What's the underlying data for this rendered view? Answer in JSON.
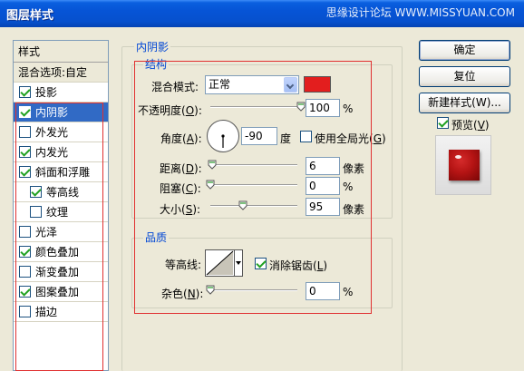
{
  "window": {
    "title": "图层样式",
    "watermark": "思缘设计论坛 WWW.MISSYUAN.COM"
  },
  "style_list": {
    "header": "样式",
    "blend_options": "混合选项:自定",
    "items": [
      {
        "label": "投影",
        "checked": true,
        "sub": false,
        "selected": false
      },
      {
        "label": "内阴影",
        "checked": true,
        "sub": false,
        "selected": true
      },
      {
        "label": "外发光",
        "checked": false,
        "sub": false,
        "selected": false
      },
      {
        "label": "内发光",
        "checked": true,
        "sub": false,
        "selected": false
      },
      {
        "label": "斜面和浮雕",
        "checked": true,
        "sub": false,
        "selected": false
      },
      {
        "label": "等高线",
        "checked": true,
        "sub": true,
        "selected": false
      },
      {
        "label": "纹理",
        "checked": false,
        "sub": true,
        "selected": false
      },
      {
        "label": "光泽",
        "checked": false,
        "sub": false,
        "selected": false
      },
      {
        "label": "颜色叠加",
        "checked": true,
        "sub": false,
        "selected": false
      },
      {
        "label": "渐变叠加",
        "checked": false,
        "sub": false,
        "selected": false
      },
      {
        "label": "图案叠加",
        "checked": true,
        "sub": false,
        "selected": false
      },
      {
        "label": "描边",
        "checked": false,
        "sub": false,
        "selected": false
      }
    ]
  },
  "panel": {
    "title": "内阴影",
    "structure": {
      "title": "结构",
      "blend_mode_label": "混合模式:",
      "blend_mode_value": "正常",
      "shadow_color": "#e31e1e",
      "opacity_label": "不透明度(",
      "opacity_key": "O",
      "opacity_value": "100",
      "opacity_unit": "%",
      "opacity_fraction": 1.0,
      "angle_label": "角度(",
      "angle_key": "A",
      "angle_value": "-90",
      "angle_unit": "度",
      "global_light_label": "使用全局光(",
      "global_light_key": "G",
      "global_light_checked": false,
      "distance_label": "距离(",
      "distance_key": "D",
      "distance_value": "6",
      "distance_unit": "像素",
      "distance_fraction": 0.02,
      "choke_label": "阻塞(",
      "choke_key": "C",
      "choke_value": "0",
      "choke_unit": "%",
      "choke_fraction": 0.0,
      "size_label": "大小(",
      "size_key": "S",
      "size_value": "95",
      "size_unit": "像素",
      "size_fraction": 0.38
    },
    "quality": {
      "title": "品质",
      "contour_label": "等高线:",
      "antialias_label": "消除锯齿(",
      "antialias_key": "L",
      "antialias_checked": true,
      "noise_label": "杂色(",
      "noise_key": "N",
      "noise_value": "0",
      "noise_unit": "%",
      "noise_fraction": 0.0
    }
  },
  "buttons": {
    "ok": "确定",
    "reset": "复位",
    "new_style": "新建样式(W)...",
    "preview_label": "预览(",
    "preview_key": "V",
    "preview_checked": true
  }
}
